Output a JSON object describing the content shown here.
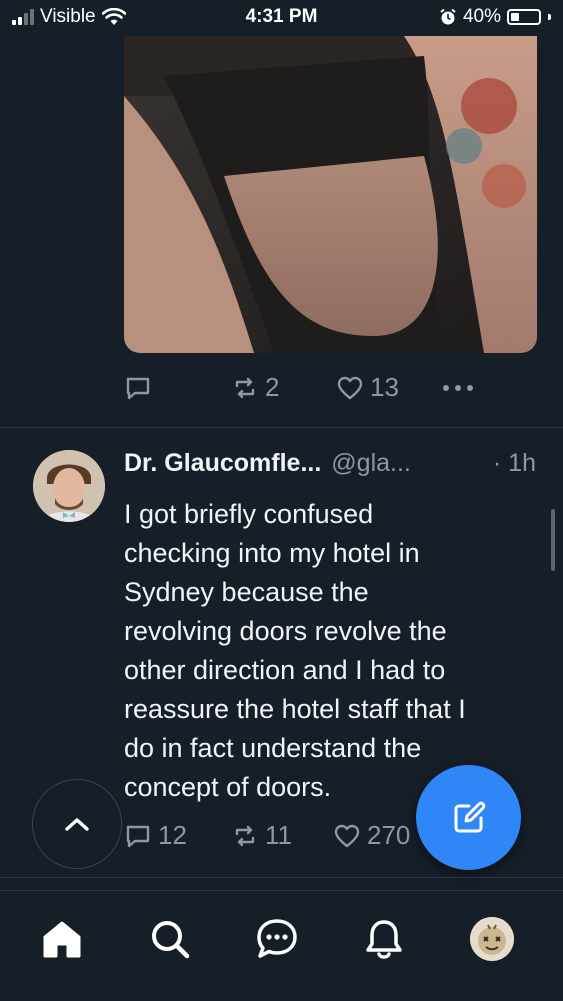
{
  "status_bar": {
    "carrier": "Visible",
    "time": "4:31 PM",
    "battery": "40%",
    "battery_level": 0.4
  },
  "post_1": {
    "retweet_count": "2",
    "like_count": "13"
  },
  "post_2": {
    "display_name": "Dr. Glaucomfle...",
    "handle": "@gla...",
    "time": "· 1h",
    "text": "I got briefly confused\nchecking into my hotel in\nSydney because the\nrevolving doors revolve the\nother direction and I had to\nreassure the hotel staff that I\ndo in fact understand the\nconcept of doors.",
    "reply_count": "12",
    "retweet_count": "11",
    "like_count": "270"
  },
  "tab_bar": {
    "items": [
      "home-icon",
      "search-icon",
      "messages-icon",
      "notifications-icon",
      "profile-avatar"
    ]
  },
  "colors": {
    "background": "#161e27",
    "accent": "#2f86f6",
    "muted": "#8b98a8"
  }
}
